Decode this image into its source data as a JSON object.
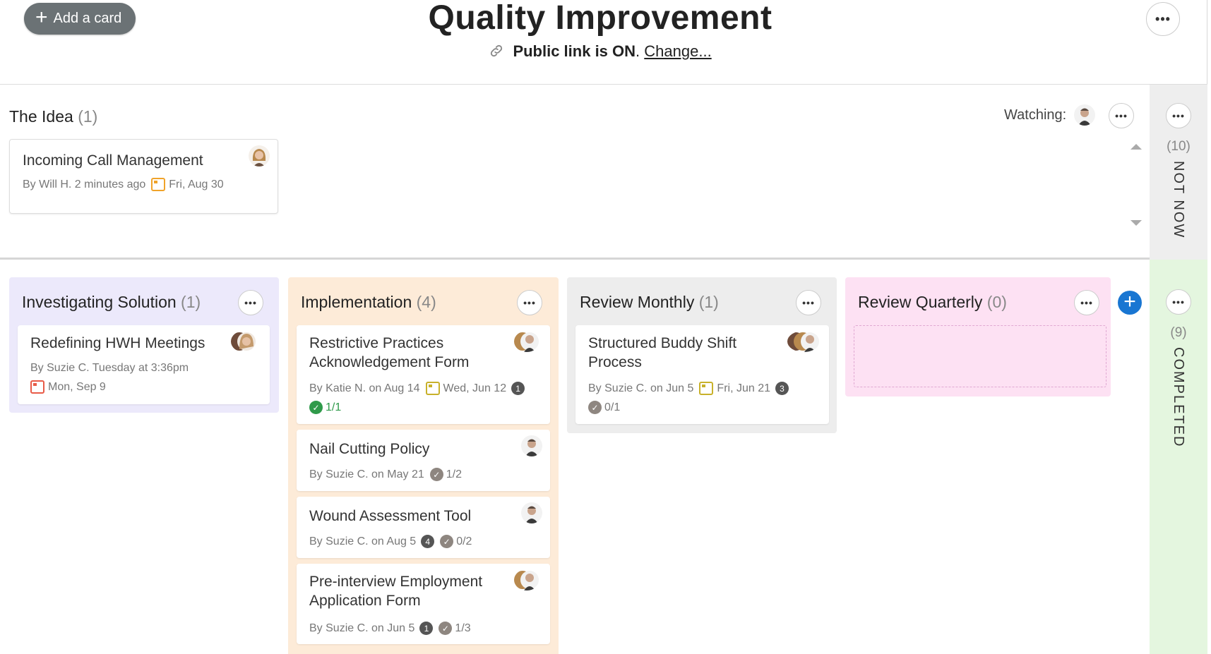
{
  "header": {
    "add_card_label": "Add a card",
    "title": "Quality Improvement",
    "public_link_status": "Public link is ON",
    "public_link_period": ".",
    "change_label": "Change..."
  },
  "idea_lane": {
    "title": "The Idea",
    "count": "(1)",
    "watching_label": "Watching:",
    "cards": [
      {
        "title": "Incoming Call Management",
        "author": "By Will H. 2 minutes ago",
        "due": "Fri, Aug 30"
      }
    ]
  },
  "not_now": {
    "count": "(10)",
    "label": "NOT NOW"
  },
  "completed": {
    "count": "(9)",
    "label": "COMPLETED"
  },
  "columns": [
    {
      "title": "Investigating Solution",
      "count": "(1)",
      "color": "#ece9fb",
      "cards": [
        {
          "title": "Redefining HWH Meetings",
          "author": "By Suzie C. Tuesday at 3:36pm",
          "due": "Mon, Sep 9"
        }
      ]
    },
    {
      "title": "Implementation",
      "count": "(4)",
      "color": "#fdebd8",
      "cards": [
        {
          "title_line1": "Restrictive Practices",
          "title_line2": "Acknowledgement Form",
          "author": "By Katie N. on Aug 14",
          "due": "Wed, Jun 12",
          "comments": "1",
          "checklist": "1/1"
        },
        {
          "title": "Nail Cutting Policy",
          "author": "By Suzie C. on May 21",
          "checklist": "1/2"
        },
        {
          "title": "Wound Assessment Tool",
          "author": "By Suzie C. on Aug 5",
          "comments": "4",
          "checklist": "0/2"
        },
        {
          "title_line1": "Pre-interview Employment",
          "title_line2": "Application Form",
          "author": "By Suzie C. on Jun 5",
          "comments": "1",
          "checklist": "1/3"
        }
      ]
    },
    {
      "title": "Review Monthly",
      "count": "(1)",
      "color": "#ededed",
      "cards": [
        {
          "title_line1": "Structured Buddy Shift",
          "title_line2": "Process",
          "author": "By Suzie C. on Jun 5",
          "due": "Fri, Jun 21",
          "comments": "3",
          "checklist": "0/1"
        }
      ]
    },
    {
      "title": "Review Quarterly",
      "count": "(0)",
      "color": "#fde1f3",
      "cards": []
    }
  ],
  "icons": {
    "checkmark": "✓",
    "plus": "+"
  },
  "colors": {
    "accent": "#1976d2",
    "completed_bg": "#e4f6df",
    "not_now_bg": "#eeeeee"
  }
}
